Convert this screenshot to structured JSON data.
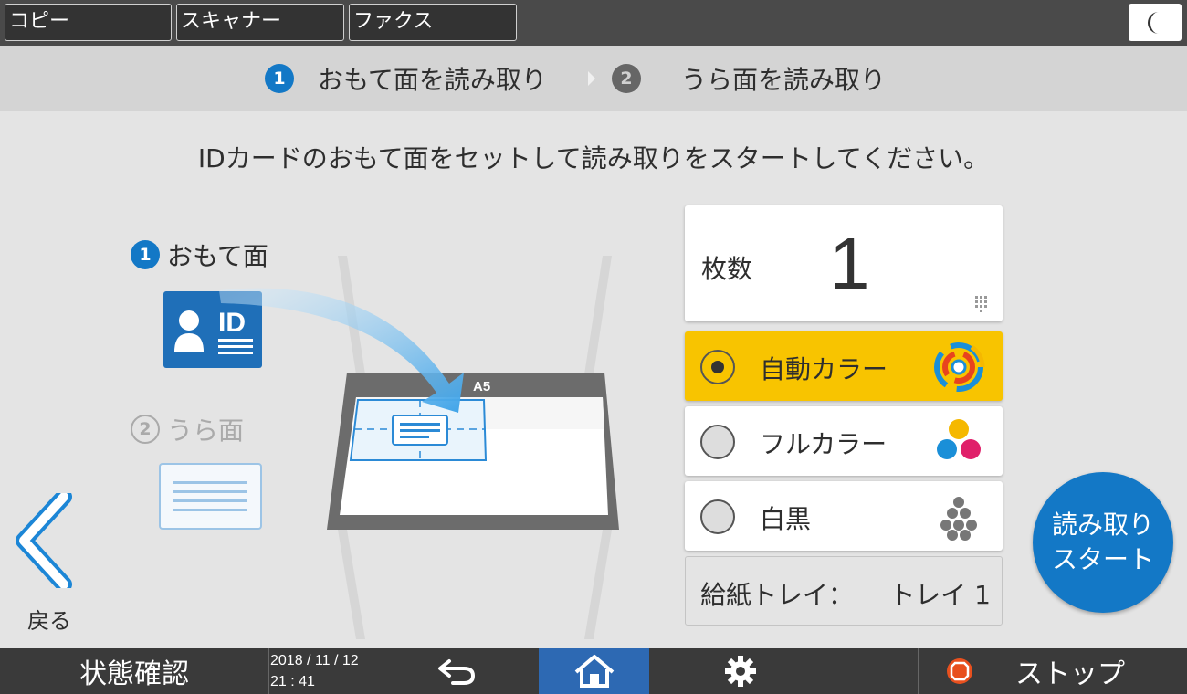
{
  "top_tabs": [
    {
      "label": "コピー"
    },
    {
      "label": "スキャナー"
    },
    {
      "label": "ファクス"
    }
  ],
  "energy_icon": "moon-icon",
  "steps": [
    {
      "number": "1",
      "label": "おもて面を読み取り",
      "active": true
    },
    {
      "number": "2",
      "label": "うら面を読み取り",
      "active": false
    }
  ],
  "instruction": "IDカードのおもて面をセットして読み取りをスタートしてください。",
  "illustration": {
    "front_number": "1",
    "front_label": "おもて面",
    "back_number": "2",
    "back_label": "うら面",
    "card_text": "ID",
    "glass_size": "A5"
  },
  "copies": {
    "label": "枚数",
    "value": "1"
  },
  "color_modes": [
    {
      "label": "自動カラー",
      "selected": true,
      "icon": "auto-color-icon"
    },
    {
      "label": "フルカラー",
      "selected": false,
      "icon": "full-color-icon"
    },
    {
      "label": "白黒",
      "selected": false,
      "icon": "black-white-icon"
    }
  ],
  "paper_tray": {
    "label": "給紙トレイ：",
    "value": "トレイ 1"
  },
  "start_button": {
    "line1": "読み取り",
    "line2": "スタート"
  },
  "back_button": {
    "label": "戻る"
  },
  "bottom_bar": {
    "status_label": "状態確認",
    "date": "2018 / 11 / 12",
    "time": "21 : 41",
    "stop_label": "ストップ"
  },
  "colors": {
    "accent_blue": "#1378c6",
    "selected_yellow": "#f8c400",
    "home_blue": "#2d69b3",
    "stop_orange": "#e8501e"
  }
}
